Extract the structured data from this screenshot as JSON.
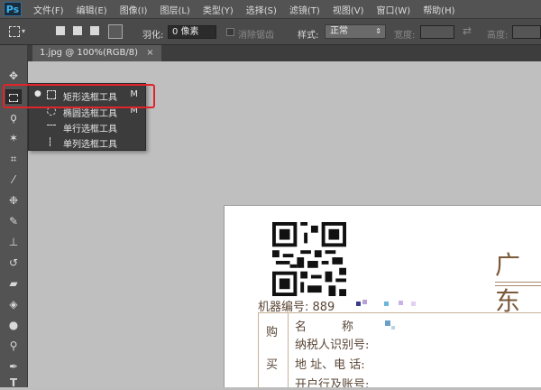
{
  "app": {
    "logo": "Ps"
  },
  "menubar": {
    "items": [
      "文件(F)",
      "编辑(E)",
      "图像(I)",
      "图层(L)",
      "类型(Y)",
      "选择(S)",
      "滤镜(T)",
      "视图(V)",
      "窗口(W)",
      "帮助(H)"
    ]
  },
  "options": {
    "feather_label": "羽化:",
    "feather_value": "0 像素",
    "antialias_label": "消除锯齿",
    "style_label": "样式:",
    "style_value": "正常",
    "width_label": "宽度:",
    "height_label": "高度:"
  },
  "tab": {
    "title": "1.jpg @ 100%(RGB/8)",
    "close": "×"
  },
  "flyout": {
    "items": [
      {
        "label": "矩形选框工具",
        "key": "M",
        "selected": true,
        "icon": "rect-marquee-icon"
      },
      {
        "label": "椭圆选框工具",
        "key": "M",
        "selected": false,
        "icon": "elliptical-marquee-icon"
      },
      {
        "label": "单行选框工具",
        "key": "",
        "selected": false,
        "icon": "single-row-marquee-icon"
      },
      {
        "label": "单列选框工具",
        "key": "",
        "selected": false,
        "icon": "single-column-marquee-icon"
      }
    ]
  },
  "tools": [
    "move-icon",
    "marquee-icon",
    "lasso-icon",
    "magic-wand-icon",
    "crop-icon",
    "eyedropper-icon",
    "healing-brush-icon",
    "brush-icon",
    "clone-stamp-icon",
    "history-brush-icon",
    "eraser-icon",
    "paint-bucket-icon",
    "blur-icon",
    "dodge-icon",
    "pen-icon",
    "type-icon"
  ],
  "document": {
    "title_fragment": "广东",
    "machine_label": "机器编号: 889",
    "buyer_col": [
      "购",
      "买"
    ],
    "rows": [
      "名　　　称",
      "纳税人识别号:",
      "地 址、电 话:",
      "开户行及账号:"
    ]
  },
  "colors": {
    "accent_red": "#e0242a",
    "doc_text": "#5a4636"
  }
}
